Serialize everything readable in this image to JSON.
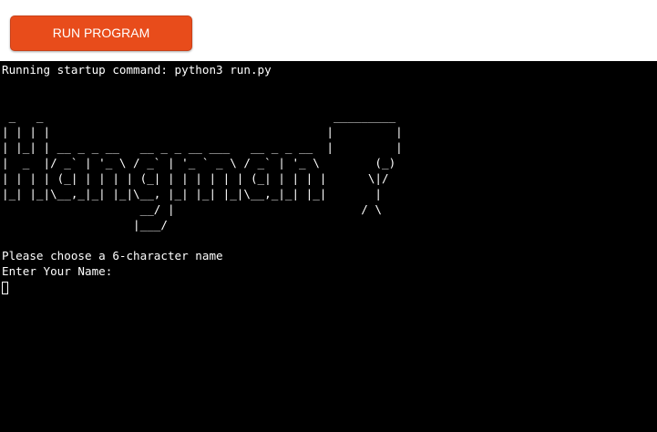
{
  "toolbar": {
    "run_button_label": "RUN PROGRAM"
  },
  "terminal": {
    "startup_line": "Running startup command: python3 run.py",
    "ascii_art": " _   _                                          _________\n| | | |                                        |         |\n| |_| | __ _ _ __   __ _ _ __ ___   __ _ _ __  |         |\n|  _  |/ _` | '_ \\ / _` | '_ ` _ \\ / _` | '_ \\        (_)\n| | | | (_| | | | | (_| | | | | | | (_| | | | |      \\|/\n|_| |_|\\__,_|_| |_|\\__, |_| |_| |_|\\__,_|_| |_|       |\n                    __/ |                           / \\\n                   |___/",
    "prompt_line": "Please choose a 6-character name",
    "input_label": "Enter Your Name:"
  }
}
